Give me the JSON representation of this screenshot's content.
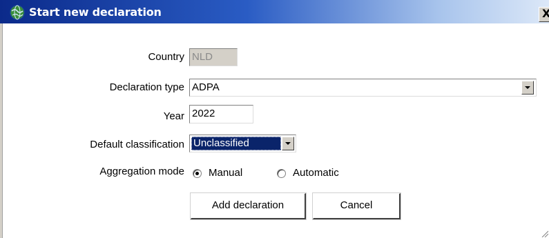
{
  "window": {
    "title": "Start new declaration",
    "close_label": "X",
    "icon": "globe-icon"
  },
  "form": {
    "country": {
      "label": "Country",
      "value": "NLD",
      "disabled": true
    },
    "declaration_type": {
      "label": "Declaration type",
      "value": "ADPA"
    },
    "year": {
      "label": "Year",
      "value": "2022"
    },
    "default_classification": {
      "label": "Default classification",
      "value": "Unclassified"
    },
    "aggregation_mode": {
      "label": "Aggregation mode",
      "options": [
        {
          "label": "Manual",
          "checked": true
        },
        {
          "label": "Automatic",
          "checked": false
        }
      ]
    }
  },
  "buttons": {
    "add_label": "Add declaration",
    "cancel_label": "Cancel"
  },
  "colors": {
    "titlebar_start": "#0b2a8a",
    "titlebar_end": "#dce8f8",
    "selection": "#0a246a",
    "disabled_bg": "#d4d0c8"
  }
}
